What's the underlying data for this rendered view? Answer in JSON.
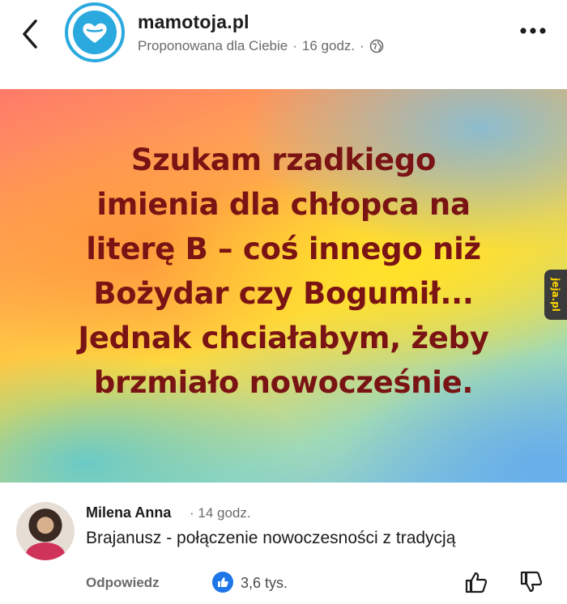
{
  "header": {
    "page_name": "mamotoja.pl",
    "suggested_label": "Proponowana dla Ciebie",
    "separator": "·",
    "time": "16 godz.",
    "separator2": "·"
  },
  "post": {
    "text": "Szukam rzadkiego\nimienia dla chłopca na\nliterę B – coś innego niż\nBożydar czy Bogumił...\nJednak chciałabym, żeby\nbrzmiało nowocześnie.",
    "watermark": "jeja.pl"
  },
  "comment": {
    "author": "Milena Anna",
    "time": "· 14 godz.",
    "text": "Brajanusz - połączenie nowoczesności z tradycją",
    "reply_label": "Odpowiedz",
    "like_count": "3,6 tys."
  },
  "icons": {
    "back": "chevron-left-icon",
    "more": "more-horizontal-icon",
    "globe": "globe-icon",
    "thumb_up": "thumb-up-icon",
    "thumb_down": "thumb-down-icon"
  },
  "colors": {
    "brand": "#2aa9df",
    "post_text": "#7a1414",
    "like_blue": "#1f76e8"
  }
}
